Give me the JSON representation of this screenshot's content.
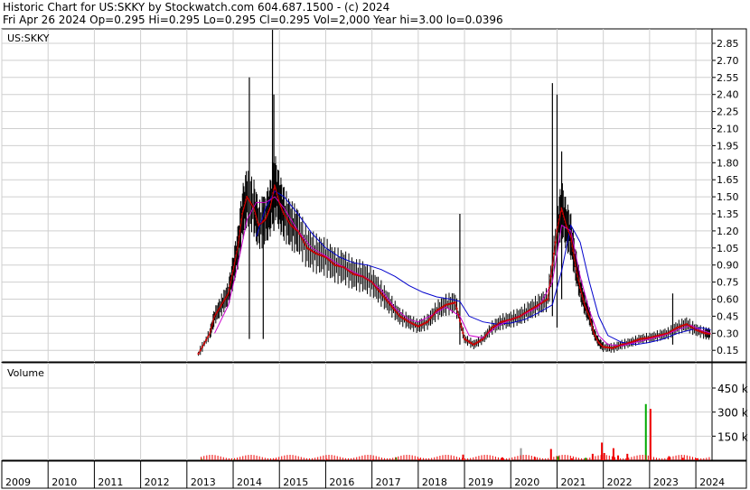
{
  "header": {
    "line1": "Historic Chart for US:SKKY by Stockwatch.com 604.687.1500 - (c) 2024",
    "line2": "Fri Apr 26 2024   Op=0.295   Hi=0.295   Lo=0.295   Cl=0.295   Vol=2,000   Year hi=3.00   lo=0.0396"
  },
  "chart_data": {
    "type": "line",
    "symbol": "US:SKKY",
    "volume_label": "Volume",
    "y_ticks": [
      "2.85",
      "2.70",
      "2.55",
      "2.40",
      "2.25",
      "2.10",
      "1.95",
      "1.80",
      "1.65",
      "1.50",
      "1.35",
      "1.20",
      "1.05",
      "0.90",
      "0.75",
      "0.60",
      "0.45",
      "0.30",
      "0.15"
    ],
    "volume_ticks": [
      "450 k",
      "300 k",
      "150 k"
    ],
    "x_ticks": [
      "2009",
      "2010",
      "2011",
      "2012",
      "2013",
      "2014",
      "2015",
      "2016",
      "2017",
      "2018",
      "2019",
      "2020",
      "2021",
      "2022",
      "2023",
      "2024"
    ],
    "price_close": [
      [
        2013.25,
        0.12
      ],
      [
        2013.5,
        0.3
      ],
      [
        2013.6,
        0.45
      ],
      [
        2013.75,
        0.55
      ],
      [
        2013.9,
        0.65
      ],
      [
        2014.0,
        0.85
      ],
      [
        2014.1,
        1.05
      ],
      [
        2014.2,
        1.35
      ],
      [
        2014.3,
        1.5
      ],
      [
        2014.45,
        1.4
      ],
      [
        2014.55,
        1.25
      ],
      [
        2014.7,
        1.3
      ],
      [
        2014.8,
        1.4
      ],
      [
        2014.9,
        1.6
      ],
      [
        2015.0,
        1.45
      ],
      [
        2015.1,
        1.35
      ],
      [
        2015.25,
        1.25
      ],
      [
        2015.4,
        1.2
      ],
      [
        2015.6,
        1.05
      ],
      [
        2015.8,
        1.0
      ],
      [
        2016.0,
        0.97
      ],
      [
        2016.2,
        0.9
      ],
      [
        2016.4,
        0.88
      ],
      [
        2016.6,
        0.82
      ],
      [
        2016.8,
        0.8
      ],
      [
        2017.0,
        0.75
      ],
      [
        2017.2,
        0.65
      ],
      [
        2017.4,
        0.55
      ],
      [
        2017.6,
        0.45
      ],
      [
        2017.8,
        0.4
      ],
      [
        2018.0,
        0.36
      ],
      [
        2018.2,
        0.4
      ],
      [
        2018.4,
        0.5
      ],
      [
        2018.6,
        0.55
      ],
      [
        2018.8,
        0.57
      ],
      [
        2019.0,
        0.25
      ],
      [
        2019.2,
        0.2
      ],
      [
        2019.4,
        0.25
      ],
      [
        2019.6,
        0.35
      ],
      [
        2019.8,
        0.4
      ],
      [
        2020.0,
        0.42
      ],
      [
        2020.2,
        0.45
      ],
      [
        2020.4,
        0.5
      ],
      [
        2020.6,
        0.55
      ],
      [
        2020.8,
        0.6
      ],
      [
        2021.0,
        1.2
      ],
      [
        2021.1,
        1.4
      ],
      [
        2021.2,
        1.25
      ],
      [
        2021.3,
        1.15
      ],
      [
        2021.4,
        0.9
      ],
      [
        2021.5,
        0.7
      ],
      [
        2021.6,
        0.55
      ],
      [
        2021.7,
        0.45
      ],
      [
        2021.8,
        0.3
      ],
      [
        2021.9,
        0.22
      ],
      [
        2022.0,
        0.18
      ],
      [
        2022.2,
        0.17
      ],
      [
        2022.4,
        0.2
      ],
      [
        2022.6,
        0.22
      ],
      [
        2022.8,
        0.25
      ],
      [
        2023.0,
        0.26
      ],
      [
        2023.2,
        0.28
      ],
      [
        2023.4,
        0.3
      ],
      [
        2023.6,
        0.35
      ],
      [
        2023.8,
        0.38
      ],
      [
        2024.0,
        0.33
      ],
      [
        2024.2,
        0.3
      ],
      [
        2024.32,
        0.295
      ]
    ],
    "ma_short": [
      [
        2013.6,
        0.3
      ],
      [
        2013.9,
        0.55
      ],
      [
        2014.1,
        0.9
      ],
      [
        2014.3,
        1.3
      ],
      [
        2014.5,
        1.45
      ],
      [
        2014.7,
        1.45
      ],
      [
        2014.9,
        1.5
      ],
      [
        2015.1,
        1.4
      ],
      [
        2015.4,
        1.2
      ],
      [
        2015.7,
        1.05
      ],
      [
        2016.0,
        0.98
      ],
      [
        2016.3,
        0.9
      ],
      [
        2016.6,
        0.84
      ],
      [
        2016.9,
        0.78
      ],
      [
        2017.2,
        0.68
      ],
      [
        2017.5,
        0.52
      ],
      [
        2017.8,
        0.42
      ],
      [
        2018.0,
        0.4
      ],
      [
        2018.3,
        0.46
      ],
      [
        2018.6,
        0.53
      ],
      [
        2018.9,
        0.45
      ],
      [
        2019.1,
        0.28
      ],
      [
        2019.4,
        0.26
      ],
      [
        2019.7,
        0.36
      ],
      [
        2020.0,
        0.42
      ],
      [
        2020.3,
        0.47
      ],
      [
        2020.6,
        0.53
      ],
      [
        2020.9,
        0.75
      ],
      [
        2021.1,
        1.25
      ],
      [
        2021.3,
        1.2
      ],
      [
        2021.5,
        0.8
      ],
      [
        2021.7,
        0.5
      ],
      [
        2021.9,
        0.28
      ],
      [
        2022.1,
        0.2
      ],
      [
        2022.4,
        0.19
      ],
      [
        2022.7,
        0.22
      ],
      [
        2023.0,
        0.25
      ],
      [
        2023.3,
        0.28
      ],
      [
        2023.6,
        0.33
      ],
      [
        2023.9,
        0.37
      ],
      [
        2024.1,
        0.33
      ],
      [
        2024.32,
        0.3
      ]
    ],
    "ma_long": [
      [
        2014.5,
        1.15
      ],
      [
        2014.7,
        1.4
      ],
      [
        2014.9,
        1.55
      ],
      [
        2015.1,
        1.5
      ],
      [
        2015.4,
        1.35
      ],
      [
        2015.7,
        1.18
      ],
      [
        2016.0,
        1.05
      ],
      [
        2016.3,
        0.97
      ],
      [
        2016.6,
        0.92
      ],
      [
        2016.9,
        0.9
      ],
      [
        2017.2,
        0.86
      ],
      [
        2017.5,
        0.8
      ],
      [
        2017.8,
        0.72
      ],
      [
        2018.1,
        0.66
      ],
      [
        2018.4,
        0.62
      ],
      [
        2018.7,
        0.6
      ],
      [
        2018.9,
        0.58
      ],
      [
        2019.1,
        0.45
      ],
      [
        2019.4,
        0.4
      ],
      [
        2019.7,
        0.38
      ],
      [
        2020.0,
        0.39
      ],
      [
        2020.3,
        0.42
      ],
      [
        2020.6,
        0.48
      ],
      [
        2020.9,
        0.55
      ],
      [
        2021.1,
        0.85
      ],
      [
        2021.3,
        1.25
      ],
      [
        2021.5,
        1.1
      ],
      [
        2021.7,
        0.75
      ],
      [
        2021.9,
        0.45
      ],
      [
        2022.1,
        0.28
      ],
      [
        2022.4,
        0.22
      ],
      [
        2022.7,
        0.2
      ],
      [
        2023.0,
        0.22
      ],
      [
        2023.3,
        0.25
      ],
      [
        2023.6,
        0.3
      ],
      [
        2023.9,
        0.33
      ],
      [
        2024.1,
        0.35
      ],
      [
        2024.32,
        0.33
      ]
    ],
    "spikes": [
      [
        2014.35,
        0.25,
        2.55
      ],
      [
        2014.65,
        0.25,
        1.5
      ],
      [
        2014.85,
        1.4,
        3.0
      ],
      [
        2014.88,
        1.2,
        2.4
      ],
      [
        2018.9,
        0.2,
        1.35
      ],
      [
        2020.9,
        0.45,
        2.5
      ],
      [
        2021.0,
        0.35,
        2.4
      ],
      [
        2021.1,
        0.6,
        1.9
      ],
      [
        2023.5,
        0.2,
        0.65
      ]
    ],
    "volume": [
      [
        2013.3,
        8,
        "green"
      ],
      [
        2014.0,
        5,
        "green"
      ],
      [
        2014.9,
        6,
        "red"
      ],
      [
        2016.0,
        8,
        "red"
      ],
      [
        2017.0,
        6,
        "red"
      ],
      [
        2017.5,
        18,
        "green"
      ],
      [
        2018.0,
        8,
        "red"
      ],
      [
        2018.95,
        35,
        "red"
      ],
      [
        2019.8,
        18,
        "red"
      ],
      [
        2020.2,
        75,
        "gray"
      ],
      [
        2020.5,
        20,
        "red"
      ],
      [
        2020.85,
        70,
        "red"
      ],
      [
        2021.0,
        25,
        "green"
      ],
      [
        2021.3,
        12,
        "red"
      ],
      [
        2021.6,
        15,
        "green"
      ],
      [
        2021.75,
        40,
        "red"
      ],
      [
        2021.95,
        110,
        "red"
      ],
      [
        2022.0,
        45,
        "red"
      ],
      [
        2022.2,
        75,
        "red"
      ],
      [
        2022.3,
        30,
        "red"
      ],
      [
        2022.5,
        40,
        "red"
      ],
      [
        2022.9,
        350,
        "green"
      ],
      [
        2023.0,
        320,
        "red"
      ],
      [
        2023.4,
        25,
        "red"
      ],
      [
        2023.7,
        15,
        "red"
      ],
      [
        2024.0,
        12,
        "red"
      ]
    ],
    "colors": {
      "price": "#000000",
      "ma_short": "#cc00cc",
      "ma_long": "#0000cc",
      "dots": "#cc0000",
      "vol_red": "#ee0000",
      "vol_green": "#00aa00",
      "vol_gray": "#999999"
    }
  }
}
